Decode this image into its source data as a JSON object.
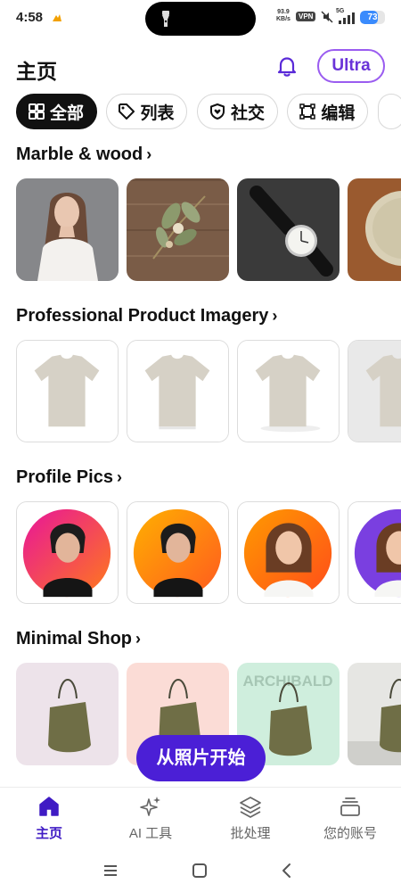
{
  "status_bar": {
    "time": "4:58",
    "speed_value": "93.9",
    "speed_unit": "KB/s",
    "vpn": "VPN",
    "network": "5G",
    "battery": "73",
    "battery_level": 0.73
  },
  "header": {
    "title": "主页",
    "ultra_label": "Ultra"
  },
  "chips": [
    {
      "label": "全部",
      "icon": "grid-icon",
      "active": true
    },
    {
      "label": "列表",
      "icon": "tag-icon",
      "active": false
    },
    {
      "label": "社交",
      "icon": "heart-shield-icon",
      "active": false
    },
    {
      "label": "编辑",
      "icon": "crop-frame-icon",
      "active": false
    }
  ],
  "sections": [
    {
      "title": "Marble & wood",
      "chevron": "›",
      "items": [
        "woman-portrait",
        "dried-flowers",
        "wristwatch",
        "ceramic-plate"
      ]
    },
    {
      "title": "Professional Product Imagery",
      "chevron": "›",
      "items": [
        "tshirt",
        "tshirt",
        "tshirt",
        "tshirt"
      ]
    },
    {
      "title": "Profile Pics",
      "chevron": "›",
      "items": [
        "woman-pink",
        "woman-orange",
        "woman-smile",
        "woman-purple"
      ]
    },
    {
      "title": "Minimal Shop",
      "chevron": "›",
      "items": [
        "bag-lilac",
        "bag-peach",
        "bag-mint",
        "bag-grey"
      ],
      "overlay_text": "ARCHIBALD"
    }
  ],
  "fab": {
    "label": "从照片开始"
  },
  "bottom_nav": [
    {
      "label": "主页",
      "icon": "home-icon",
      "active": true
    },
    {
      "label": "AI 工具",
      "icon": "sparkle-icon",
      "active": false
    },
    {
      "label": "批处理",
      "icon": "layers-icon",
      "active": false
    },
    {
      "label": "您的账号",
      "icon": "account-icon",
      "active": false
    }
  ],
  "colors": {
    "accent": "#4b1fd6",
    "ultra_border": "#9a5cf0",
    "ultra_text": "#6a33d8",
    "bell": "#5a2ad8"
  }
}
